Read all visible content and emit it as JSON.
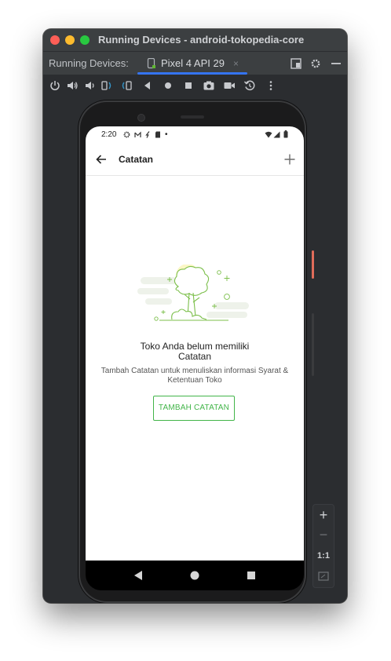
{
  "window": {
    "title": "Running Devices - android-tokopedia-core",
    "traffic_colors": [
      "#ff5f57",
      "#febc2e",
      "#28c840"
    ]
  },
  "tabbar": {
    "label": "Running Devices:",
    "tab_label": "Pixel 4 API 29",
    "tab_close": "×"
  },
  "phone": {
    "status_time": "2:20",
    "status_dot": "•",
    "screen_title": "Catatan",
    "empty_title_line1": "Toko Anda belum memiliki",
    "empty_title_line2": "Catatan",
    "empty_desc_line1": "Tambah Catatan untuk menuliskan informasi Syarat &",
    "empty_desc_line2": "Ketentuan Toko",
    "cta_label": "TAMBAH CATATAN",
    "accent": "#42b549"
  },
  "zoom": {
    "plus": "+",
    "minus": "−",
    "ratio": "1:1"
  }
}
